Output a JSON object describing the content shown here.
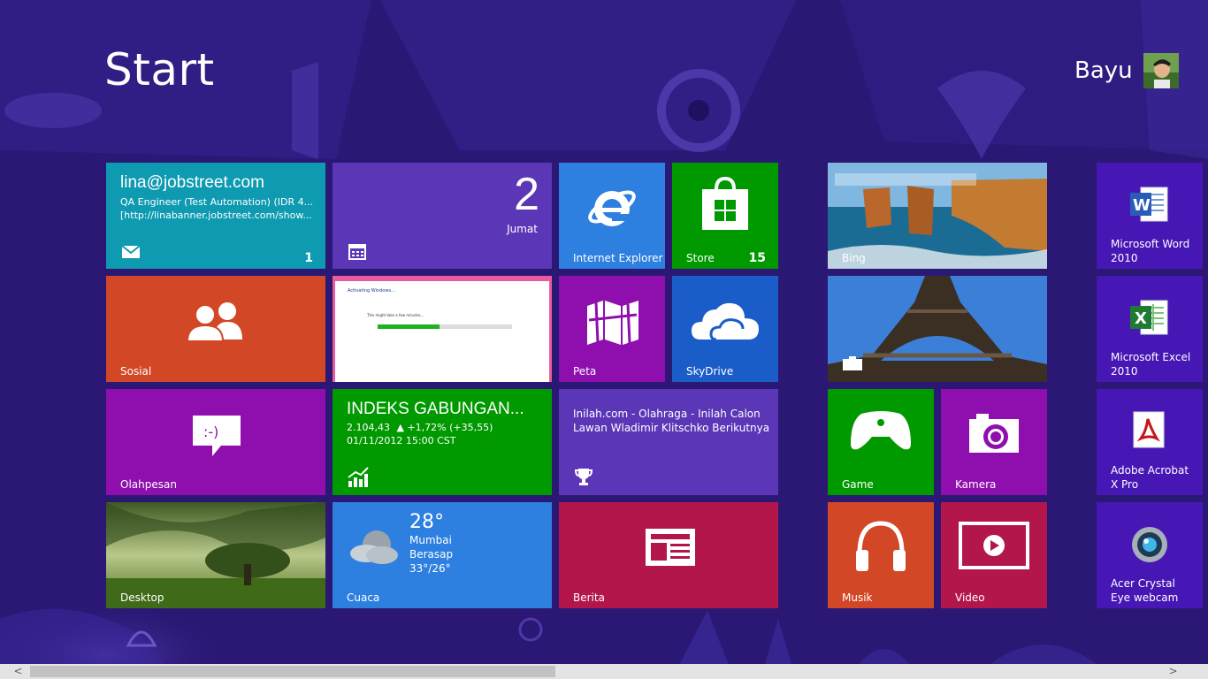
{
  "screen": {
    "title": "Start"
  },
  "user": {
    "name": "Bayu"
  },
  "tiles": {
    "mail": {
      "email": "lina@jobstreet.com",
      "line1": "QA Engineer (Test Automation) (IDR 4...",
      "line2": "[http://linabanner.jobstreet.com/show...",
      "badge": "1"
    },
    "calendar": {
      "day": "2",
      "weekday": "Jumat"
    },
    "ie": {
      "label": "Internet Explorer"
    },
    "store": {
      "label": "Store",
      "badge": "15"
    },
    "bing": {
      "label": "Bing"
    },
    "word": {
      "label": "Microsoft Word 2010"
    },
    "people": {
      "label": "Sosial"
    },
    "desktop_preview": {
      "title": "Activating Windows...",
      "message": "This might take a few minutes..."
    },
    "maps": {
      "label": "Peta"
    },
    "skydrive": {
      "label": "SkyDrive"
    },
    "excel": {
      "label": "Microsoft Excel 2010"
    },
    "messaging": {
      "label": "Olahpesan"
    },
    "finance": {
      "title": "INDEKS GABUNGAN...",
      "value": "2.104,43",
      "change": "▲ +1,72% (+35,55)",
      "datetime": "01/11/2012 15:00 CST"
    },
    "sports": {
      "headline": "Inilah.com - Olahraga - Inilah Calon Lawan Wladimir Klitschko Berikutnya"
    },
    "games": {
      "label": "Game"
    },
    "camera": {
      "label": "Kamera"
    },
    "acrobat": {
      "label": "Adobe Acrobat X Pro"
    },
    "desktop": {
      "label": "Desktop"
    },
    "weather": {
      "temp": "28°",
      "city": "Mumbai",
      "condition": "Berasap",
      "range": "33°/26°",
      "label": "Cuaca"
    },
    "news": {
      "label": "Berita"
    },
    "music": {
      "label": "Musik"
    },
    "video": {
      "label": "Video"
    },
    "webcam": {
      "label": "Acer Crystal Eye webcam"
    }
  },
  "scrollbar": {
    "left_arrow": "<",
    "right_arrow": ">"
  },
  "colors": {
    "background": "#2a1873",
    "teal": "#0e9ab1",
    "purple": "#5b37b8",
    "blue": "#2d7fe0",
    "green": "#009a00",
    "orange": "#d24726",
    "magenta": "#8f0fae",
    "darkblue": "#1b5dc8",
    "red": "#b3164a",
    "indigo": "#4617b4"
  }
}
